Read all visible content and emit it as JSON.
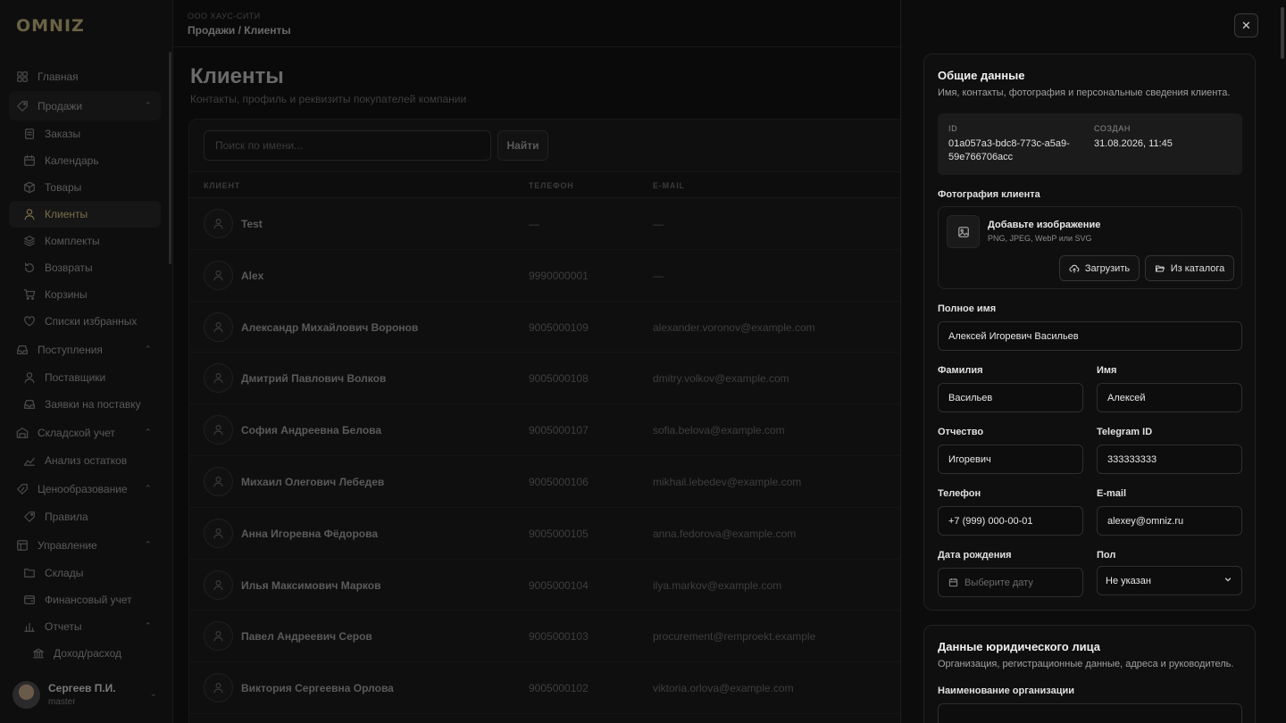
{
  "app": {
    "logo": "OMNIZ"
  },
  "sidebar": {
    "items": [
      {
        "label": "Главная",
        "level": 0,
        "icon": "home-icon"
      },
      {
        "label": "Продажи",
        "level": 0,
        "icon": "sales-icon",
        "expanded": true
      },
      {
        "label": "Заказы",
        "level": 1,
        "icon": "orders-icon"
      },
      {
        "label": "Календарь",
        "level": 1,
        "icon": "calendar-icon"
      },
      {
        "label": "Товары",
        "level": 1,
        "icon": "box-icon"
      },
      {
        "label": "Клиенты",
        "level": 1,
        "icon": "user-icon",
        "active": true
      },
      {
        "label": "Комплекты",
        "level": 1,
        "icon": "layers-icon"
      },
      {
        "label": "Возвраты",
        "level": 1,
        "icon": "return-icon"
      },
      {
        "label": "Корзины",
        "level": 1,
        "icon": "cart-icon"
      },
      {
        "label": "Списки избранных",
        "level": 1,
        "icon": "heart-icon"
      },
      {
        "label": "Поступления",
        "level": 0,
        "icon": "inbox-icon",
        "expanded": true
      },
      {
        "label": "Поставщики",
        "level": 1,
        "icon": "user-icon"
      },
      {
        "label": "Заявки на поставку",
        "level": 1,
        "icon": "inbox-icon"
      },
      {
        "label": "Складской учет",
        "level": 0,
        "icon": "warehouse-icon",
        "expanded": true
      },
      {
        "label": "Анализ остатков",
        "level": 1,
        "icon": "chart-icon"
      },
      {
        "label": "Ценообразование",
        "level": 0,
        "icon": "percent-icon",
        "expanded": true
      },
      {
        "label": "Правила",
        "level": 1,
        "icon": "tag-icon"
      },
      {
        "label": "Управление",
        "level": 0,
        "icon": "grid-icon",
        "expanded": true
      },
      {
        "label": "Склады",
        "level": 1,
        "icon": "folder-icon"
      },
      {
        "label": "Финансовый учет",
        "level": 1,
        "icon": "wallet-icon"
      },
      {
        "label": "Отчеты",
        "level": 1,
        "icon": "bar-chart-icon",
        "expanded": true
      },
      {
        "label": "Доход/расход",
        "level": 2,
        "icon": "bank-icon"
      }
    ],
    "user": {
      "name": "Сергеев П.И.",
      "role": "master"
    }
  },
  "header": {
    "org": "ООО ХАУС-СИТИ",
    "breadcrumb": "Продажи / Клиенты"
  },
  "main": {
    "title": "Клиенты",
    "subtitle": "Контакты, профиль и реквизиты покупателей компании",
    "search_placeholder": "Поиск по имени...",
    "find_label": "Найти",
    "columns": {
      "client": "КЛИЕНТ",
      "phone": "ТЕЛЕФОН",
      "email": "E-MAIL"
    },
    "rows": [
      {
        "name": "Test",
        "phone": "—",
        "email": "—"
      },
      {
        "name": "Alex",
        "phone": "9990000001",
        "email": "—"
      },
      {
        "name": "Александр Михайлович Воронов",
        "phone": "9005000109",
        "email": "alexander.voronov@example.com"
      },
      {
        "name": "Дмитрий Павлович Волков",
        "phone": "9005000108",
        "email": "dmitry.volkov@example.com"
      },
      {
        "name": "София Андреевна Белова",
        "phone": "9005000107",
        "email": "sofia.belova@example.com"
      },
      {
        "name": "Михаил Олегович Лебедев",
        "phone": "9005000106",
        "email": "mikhail.lebedev@example.com"
      },
      {
        "name": "Анна Игоревна Фёдорова",
        "phone": "9005000105",
        "email": "anna.fedorova@example.com"
      },
      {
        "name": "Илья Максимович Марков",
        "phone": "9005000104",
        "email": "ilya.markov@example.com"
      },
      {
        "name": "Павел Андреевич Серов",
        "phone": "9005000103",
        "email": "procurement@remproekt.example"
      },
      {
        "name": "Виктория Сергеевна Орлова",
        "phone": "9005000102",
        "email": "viktoria.orlova@example.com"
      }
    ]
  },
  "drawer": {
    "close": "✕",
    "general": {
      "title": "Общие данные",
      "subtitle": "Имя, контакты, фотография и персональные сведения клиента.",
      "id_label": "ID",
      "id_value": "01a057a3-bdc8-773c-a5a9-59e766706acc",
      "created_label": "СОЗДАН",
      "created_value": "31.08.2026, 11:45",
      "photo_label": "Фотография клиента",
      "photo_title": "Добавьте изображение",
      "photo_formats": "PNG, JPEG, WebP или SVG",
      "upload_label": "Загрузить",
      "catalog_label": "Из каталога",
      "full_name_label": "Полное имя",
      "full_name": "Алексей Игоревич Васильев",
      "last_name_label": "Фамилия",
      "last_name": "Васильев",
      "first_name_label": "Имя",
      "first_name": "Алексей",
      "patronymic_label": "Отчество",
      "patronymic": "Игоревич",
      "telegram_label": "Telegram ID",
      "telegram": "333333333",
      "phone_label": "Телефон",
      "phone": "+7 (999) 000-00-01",
      "email_label": "E-mail",
      "email": "alexey@omniz.ru",
      "birth_label": "Дата рождения",
      "birth_placeholder": "Выберите дату",
      "gender_label": "Пол",
      "gender": "Не указан"
    },
    "legal": {
      "title": "Данные юридического лица",
      "subtitle": "Организация, регистрационные данные, адреса и руководитель.",
      "org_label": "Наименование организации"
    }
  }
}
